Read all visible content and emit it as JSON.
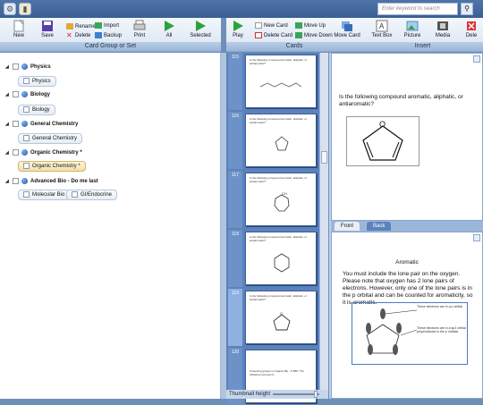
{
  "topbar": {
    "search_placeholder": "Enter keyword to search"
  },
  "ribbon_left": {
    "buttons": {
      "new": "New",
      "save": "Save",
      "print": "Print",
      "all": "All",
      "selected": "Selected"
    },
    "small": {
      "rename": "Rename",
      "delete": "Delete",
      "import": "Import",
      "backup": "Backup"
    },
    "group_label": "Card Group or Set"
  },
  "ribbon_right": {
    "buttons": {
      "play": "Play",
      "move_card": "Move Card",
      "text_box": "Text Box",
      "picture": "Picture",
      "media": "Media",
      "delete": "Dele"
    },
    "small": {
      "new_card": "New Card",
      "delete_card": "Delete Card",
      "move_up": "Move Up",
      "move_down": "Move Down"
    },
    "cards_label": "Cards",
    "insert_label": "Insert"
  },
  "tree": {
    "groups": [
      {
        "name": "Physics",
        "sets": [
          "Physics"
        ]
      },
      {
        "name": "Biology",
        "sets": [
          "Biology"
        ]
      },
      {
        "name": "General Chemistry",
        "sets": [
          "General Chemistry"
        ]
      },
      {
        "name": "Organic Chemistry *",
        "sets": [
          "Organic Chemistry *"
        ]
      },
      {
        "name": "Advanced Bio - Do me last",
        "sets": [
          "Molecular Bio",
          "GI/Endocrine"
        ]
      }
    ]
  },
  "thumbnails": {
    "items": [
      {
        "num": "115",
        "text": "Is the following compound aromatic, aliphatic, or antiaromatic?"
      },
      {
        "num": "116",
        "text": "Is the following compound aromatic, aliphatic, or antiaromatic?"
      },
      {
        "num": "117",
        "text": "Is the following compound aromatic, aliphatic, or antiaromatic?"
      },
      {
        "num": "118",
        "text": "Is the following compound aromatic, aliphatic, or antiaromatic?"
      },
      {
        "num": "119",
        "text": "Is the following compound aromatic, aliphatic, or antiaromatic?"
      },
      {
        "num": "120",
        "text": "Protecting groups in Organic Bio - 5 ZBP: The following compound..."
      }
    ],
    "footer": "Thumbnail height"
  },
  "card": {
    "question": "Is the following compound aromatic, aliphatic, or antiaromatic?",
    "tabs": {
      "front": "Front",
      "back": "Back"
    },
    "answer_title": "Aromatic",
    "answer_text": "You must include the lone pair on the oxygen.  Please note that oxygen has 2 lone pairs of electrons.  However, only one of the lone pairs is in the p orbital and can be counted for aromaticity, so it is aromatic.",
    "diagram_note1": "These electrons are in a p orbital",
    "diagram_note2": "These electrons are in a sp2 orbital perpendicular to the p orbitals"
  }
}
